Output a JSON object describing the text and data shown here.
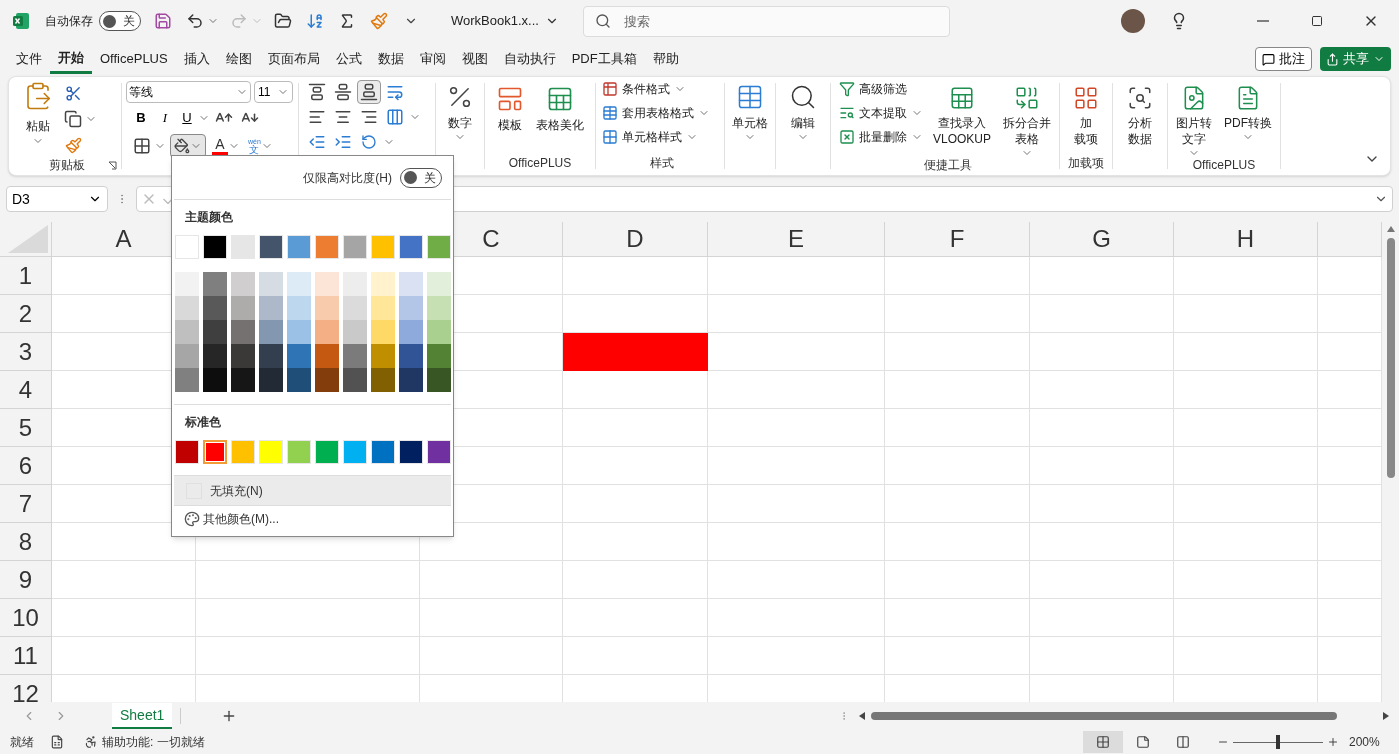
{
  "title_bar": {
    "autosave_label": "自动保存",
    "autosave": {
      "on": false,
      "label": "关"
    },
    "file_name": "WorkBook1.x...",
    "search": {
      "placeholder": "搜索"
    }
  },
  "menu_tabs": [
    {
      "label": "文件",
      "selected": false
    },
    {
      "label": "开始",
      "selected": true
    },
    {
      "label": "OfficePLUS",
      "selected": false
    },
    {
      "label": "插入",
      "selected": false
    },
    {
      "label": "绘图",
      "selected": false
    },
    {
      "label": "页面布局",
      "selected": false
    },
    {
      "label": "公式",
      "selected": false
    },
    {
      "label": "数据",
      "selected": false
    },
    {
      "label": "审阅",
      "selected": false
    },
    {
      "label": "视图",
      "selected": false
    },
    {
      "label": "自动执行",
      "selected": false
    },
    {
      "label": "PDF工具箱",
      "selected": false
    },
    {
      "label": "帮助",
      "selected": false
    }
  ],
  "comment_button": "批注",
  "share_button": "共享",
  "ribbon": {
    "clipboard": {
      "paste": "粘贴",
      "label": "剪贴板"
    },
    "font": {
      "name": "等线",
      "size": "11",
      "bold": "B",
      "italic": "I",
      "underline": "U",
      "font_color": "A",
      "phonetic": {
        "top": "wén",
        "bottom": "文"
      },
      "fill_expanded": true
    },
    "number": {
      "label": "数字"
    },
    "officeplus": {
      "items": [
        "模板",
        "表格美化"
      ],
      "label": "OfficePLUS"
    },
    "styles": {
      "items": [
        "条件格式",
        "套用表格格式",
        "单元格样式"
      ],
      "label": "样式"
    },
    "cells": {
      "label": "单元格"
    },
    "editing": {
      "label": "编辑"
    },
    "tools": {
      "small": [
        "高级筛选",
        "文本提取",
        "批量删除"
      ],
      "large": [
        [
          "查找录入",
          "VLOOKUP"
        ],
        [
          "拆分合并",
          "表格"
        ]
      ],
      "label": "便捷工具"
    },
    "addins": {
      "lines": [
        "加",
        "载项"
      ],
      "label": "加载项"
    },
    "analyze": {
      "lines": [
        "分析",
        "数据"
      ]
    },
    "officeplus2": {
      "large": [
        [
          "图片转",
          "文字"
        ],
        [
          "PDF转换"
        ]
      ],
      "label": "OfficePLUS"
    }
  },
  "formula_bar": {
    "name_box": "D3"
  },
  "sheet": {
    "columns": [
      {
        "label": "A"
      },
      {},
      {
        "label": "C"
      },
      {
        "label": "D"
      },
      {
        "label": "E"
      },
      {
        "label": "F"
      },
      {
        "label": "G"
      },
      {
        "label": "H"
      },
      {}
    ],
    "rows": [
      {
        "label": "1"
      },
      {
        "label": "2"
      },
      {
        "label": "3",
        "cells": [
          {
            "filled": false
          },
          {},
          {
            "filled": false
          },
          {
            "filled": true,
            "color": "#ff0000"
          }
        ]
      },
      {
        "label": "4"
      },
      {
        "label": "5"
      },
      {
        "label": "6"
      },
      {
        "label": "7"
      },
      {
        "label": "8"
      },
      {
        "label": "9"
      },
      {
        "label": "10"
      },
      {
        "label": "11"
      },
      {
        "label": "12"
      }
    ]
  },
  "fill_menu": {
    "high_contrast": {
      "label": "仅限高对比度(H)",
      "on": false,
      "toggle_label": "关"
    },
    "theme_label": "主题颜色",
    "theme_colors": [
      {
        "color": "#ffffff",
        "selected": false,
        "shades": [
          {
            "color": "#f2f2f2",
            "selected": false
          },
          {
            "color": "#d9d9d9",
            "selected": false
          },
          {
            "color": "#bfbfbf",
            "selected": false
          },
          {
            "color": "#a6a6a6",
            "selected": false
          },
          {
            "color": "#808080",
            "selected": false
          }
        ]
      },
      {
        "color": "#000000",
        "selected": false,
        "shades": [
          {
            "color": "#7f7f7f",
            "selected": false
          },
          {
            "color": "#595959",
            "selected": false
          },
          {
            "color": "#3f3f3f",
            "selected": false
          },
          {
            "color": "#262626",
            "selected": false
          },
          {
            "color": "#0d0d0d",
            "selected": false
          }
        ]
      },
      {
        "color": "#e7e6e6",
        "selected": false,
        "shades": [
          {
            "color": "#d0cece",
            "selected": false
          },
          {
            "color": "#aeabab",
            "selected": false
          },
          {
            "color": "#757171",
            "selected": false
          },
          {
            "color": "#3b3838",
            "selected": false
          },
          {
            "color": "#171616",
            "selected": false
          }
        ]
      },
      {
        "color": "#44546a",
        "selected": false,
        "shades": [
          {
            "color": "#d6dce4",
            "selected": false
          },
          {
            "color": "#adb9ca",
            "selected": false
          },
          {
            "color": "#8497b0",
            "selected": false
          },
          {
            "color": "#333f4f",
            "selected": false
          },
          {
            "color": "#222b35",
            "selected": false
          }
        ]
      },
      {
        "color": "#5b9bd5",
        "selected": false,
        "shades": [
          {
            "color": "#ddebf7",
            "selected": false
          },
          {
            "color": "#bdd7ee",
            "selected": false
          },
          {
            "color": "#9bc2e6",
            "selected": false
          },
          {
            "color": "#2f75b5",
            "selected": false
          },
          {
            "color": "#1f4e78",
            "selected": false
          }
        ]
      },
      {
        "color": "#ed7d31",
        "selected": false,
        "shades": [
          {
            "color": "#fce4d6",
            "selected": false
          },
          {
            "color": "#f8cbad",
            "selected": false
          },
          {
            "color": "#f4b084",
            "selected": false
          },
          {
            "color": "#c65911",
            "selected": false
          },
          {
            "color": "#833c0c",
            "selected": false
          }
        ]
      },
      {
        "color": "#a5a5a5",
        "selected": false,
        "shades": [
          {
            "color": "#ededed",
            "selected": false
          },
          {
            "color": "#dbdbdb",
            "selected": false
          },
          {
            "color": "#c9c9c9",
            "selected": false
          },
          {
            "color": "#7b7b7b",
            "selected": false
          },
          {
            "color": "#525252",
            "selected": false
          }
        ]
      },
      {
        "color": "#ffc000",
        "selected": false,
        "shades": [
          {
            "color": "#fff2cc",
            "selected": false
          },
          {
            "color": "#ffe699",
            "selected": false
          },
          {
            "color": "#ffd966",
            "selected": false
          },
          {
            "color": "#bf8f00",
            "selected": false
          },
          {
            "color": "#806000",
            "selected": false
          }
        ]
      },
      {
        "color": "#4472c4",
        "selected": false,
        "shades": [
          {
            "color": "#d9e1f2",
            "selected": false
          },
          {
            "color": "#b4c6e7",
            "selected": false
          },
          {
            "color": "#8ea9db",
            "selected": false
          },
          {
            "color": "#305496",
            "selected": false
          },
          {
            "color": "#203764",
            "selected": false
          }
        ]
      },
      {
        "color": "#70ad47",
        "selected": false,
        "shades": [
          {
            "color": "#e2efda",
            "selected": false
          },
          {
            "color": "#c6e0b4",
            "selected": false
          },
          {
            "color": "#a9d08e",
            "selected": false
          },
          {
            "color": "#548235",
            "selected": false
          },
          {
            "color": "#375623",
            "selected": false
          }
        ]
      }
    ],
    "standard_label": "标准色",
    "standard_colors": [
      {
        "color": "#c00000",
        "selected": false
      },
      {
        "color": "#ff0000",
        "selected": true
      },
      {
        "color": "#ffc000",
        "selected": false
      },
      {
        "color": "#ffff00",
        "selected": false
      },
      {
        "color": "#92d050",
        "selected": false
      },
      {
        "color": "#00b050",
        "selected": false
      },
      {
        "color": "#00b0f0",
        "selected": false
      },
      {
        "color": "#0070c0",
        "selected": false
      },
      {
        "color": "#002060",
        "selected": false
      },
      {
        "color": "#7030a0",
        "selected": false
      }
    ],
    "no_fill": {
      "label": "无填充(N)",
      "selected": true
    },
    "more_colors": "其他颜色(M)..."
  },
  "sheet_tabs": [
    {
      "label": "Sheet1",
      "selected": true
    }
  ],
  "status_bar": {
    "status": "就绪",
    "accessibility": "辅助功能: 一切就绪",
    "views": [
      {
        "kind": "normal",
        "selected": true
      },
      {
        "kind": "page_layout",
        "selected": false
      },
      {
        "kind": "page_break",
        "selected": false
      }
    ],
    "zoom": {
      "level": 0.5,
      "label": "200%"
    }
  }
}
